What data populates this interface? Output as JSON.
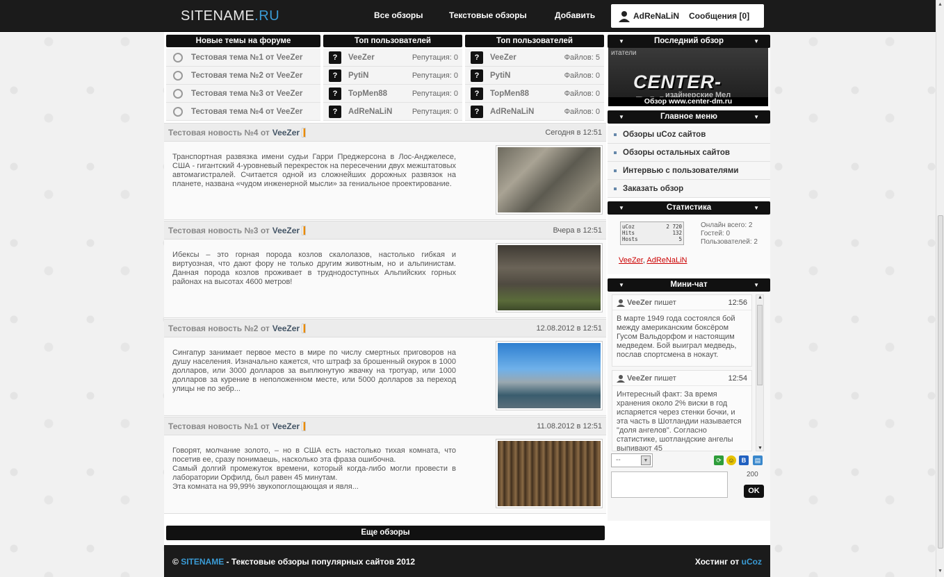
{
  "header": {
    "logo_main": "SITENAME",
    "logo_accent": ".RU",
    "nav": [
      "Все обзоры",
      "Текстовые обзоры",
      "Добавить"
    ],
    "user": "AdReNaLiN",
    "messages": "Сообщения [0]"
  },
  "forum": {
    "title": "Новые темы на форуме",
    "items": [
      "Тестовая тема №1 от VeeZer",
      "Тестовая тема №2 от VeeZer",
      "Тестовая тема №3 от VeeZer",
      "Тестовая тема №4 от VeeZer"
    ]
  },
  "top_rep": {
    "title": "Топ пользователей",
    "icon": "?",
    "items": [
      {
        "name": "VeeZer",
        "value": "Репутация: 0"
      },
      {
        "name": "PytiN",
        "value": "Репутация: 0"
      },
      {
        "name": "TopMen88",
        "value": "Репутация: 0"
      },
      {
        "name": "AdReNaLiN",
        "value": "Репутация: 0"
      }
    ]
  },
  "top_files": {
    "title": "Топ пользователей",
    "icon": "?",
    "items": [
      {
        "name": "VeeZer",
        "value": "Файлов: 5"
      },
      {
        "name": "PytiN",
        "value": "Файлов: 0"
      },
      {
        "name": "TopMen88",
        "value": "Файлов: 0"
      },
      {
        "name": "AdReNaLiN",
        "value": "Файлов: 0"
      }
    ]
  },
  "news": [
    {
      "title": "Тестовая новость №4 от",
      "author": "VeeZer",
      "date": "Сегодня в 12:51",
      "text": "Транспортная развязка имени судьи Гарри Преджерсона в Лос-Анджелесе, США - гигантский 4-уровневый перекресток на пересечении двух межштатовых автомагистралей. Считается одной из сложнейших дорожных развязок на планете, названа «чудом инженерной мысли» за гениальное проектирование."
    },
    {
      "title": "Тестовая новость №3 от",
      "author": "VeeZer",
      "date": "Вчера в 12:51",
      "text": "Ибексы – это горная порода козлов скалолазов, настолько гибкая и виртуозная, что дают фору не только другим животным, но и альпинистам. Данная порода козлов проживает в труднодоступных Альпийских горных районах на высотах 4600 метров!"
    },
    {
      "title": "Тестовая новость №2 от",
      "author": "VeeZer",
      "date": "12.08.2012 в 12:51",
      "text": "Сингапур занимает первое место в мире по числу смертных приговоров на душу населения. Изначально кажется, что штраф за брошенный окурок в 1000 долларов, или 3000 долларов за выплюнутую жвачку на тротуар, или 1000 долларов за курение в неположенном месте, или 5000 долларов за переход улицы не по зебр..."
    },
    {
      "title": "Тестовая новость №1 от",
      "author": "VeeZer",
      "date": "11.08.2012 в 12:51",
      "text": "Говорят, молчание золото, – но в США есть настолько тихая комната, что посетив ее, сразу понимаешь, насколько эта фраза ошибочна.\nСамый долгий промежуток времени, который когда-либо могли провести в лаборатории Орфилд, был равен 45 минутам.\nЭта комната на 99,99% звукопоглощающая и явля..."
    }
  ],
  "more_button": "Еще обзоры",
  "last_review": {
    "title": "Последний обзор",
    "banner_text": "CENTER-DM.R",
    "banner_sub": "изайнерские Мел",
    "banner_top": "итатели",
    "caption": "Обзор www.center-dm.ru"
  },
  "main_menu": {
    "title": "Главное меню",
    "items": [
      "Обзоры uCoz сайтов",
      "Обзоры остальных сайтов",
      "Интервью с пользователями",
      "Заказать обзор"
    ]
  },
  "stats": {
    "title": "Статистика",
    "counter": [
      [
        "uCoz",
        "2 720"
      ],
      [
        "Hits",
        "132"
      ],
      [
        "Hosts",
        "5"
      ]
    ],
    "online_total": "Онлайн всего: 2",
    "guests": "Гостей: 0",
    "users": "Пользователей: 2",
    "online_names": [
      "VeeZer",
      "AdReNaLiN"
    ]
  },
  "chat": {
    "title": "Мини-чат",
    "messages": [
      {
        "user": "VeeZer",
        "says": "пишет",
        "time": "12:56",
        "text": "В марте 1949 года состоялся бой между американским боксёром Гусом Вальдорфом и настоящим медведем. Бой выиграл медведь, послав спортсмена в нокаут."
      },
      {
        "user": "VeeZer",
        "says": "пишет",
        "time": "12:54",
        "text": "Интересный факт: За время хранения около 2% виски в год испаряется через стенки бочки, и эта часть в Шотландии называется \"доля ангелов\". Согласно статистике, шотландские ангелы выпивают 45"
      }
    ],
    "select_value": "--",
    "char_count": "200",
    "ok_label": "OK"
  },
  "footer": {
    "copyright": "©",
    "site": "SITENAME",
    "text": "- Текстовые обзоры популярных сайтов 2012",
    "hosting": "Хостинг от",
    "host_name": "uCoz"
  }
}
